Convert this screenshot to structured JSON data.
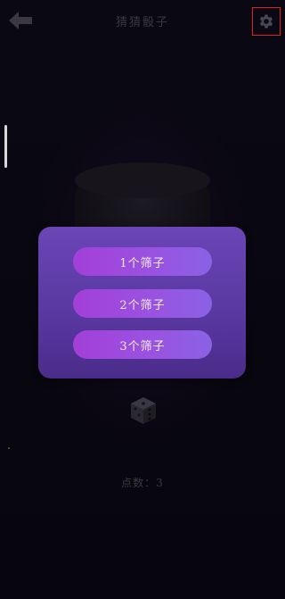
{
  "header": {
    "title": "猜猜骰子",
    "back_icon": "arrow-left-icon",
    "settings_icon": "gear-icon"
  },
  "modal": {
    "options": [
      {
        "label": "1个筛子"
      },
      {
        "label": "2个筛子"
      },
      {
        "label": "3个筛子"
      }
    ]
  },
  "footer": {
    "score_text": "点数：3",
    "dice_icon": "dice-icon"
  },
  "colors": {
    "background": "#08060f",
    "modal": "#5a39a2",
    "button": "#9a52e0",
    "highlight_border": "#e02020"
  }
}
